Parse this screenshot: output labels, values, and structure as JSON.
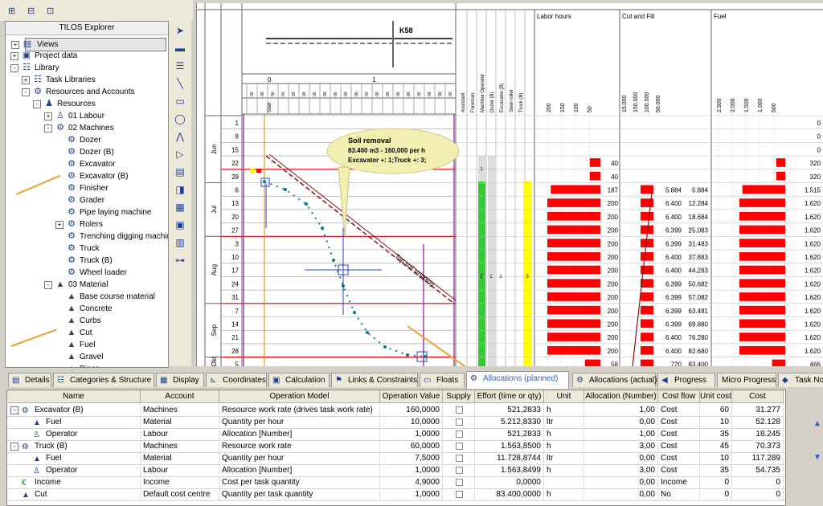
{
  "explorer": {
    "title": "TILOS Explorer",
    "items": [
      {
        "label": "Views",
        "level": 0,
        "exp": "+",
        "icon": "views-icon"
      },
      {
        "label": "Project data",
        "level": 0,
        "exp": "+",
        "icon": "project-data-icon"
      },
      {
        "label": "Library",
        "level": 0,
        "exp": "-",
        "icon": "library-icon"
      },
      {
        "label": "Task Libraries",
        "level": 1,
        "exp": "+",
        "icon": "task-library-icon"
      },
      {
        "label": "Resources and Accounts",
        "level": 1,
        "exp": "-",
        "icon": "resources-accounts-icon"
      },
      {
        "label": "Resources",
        "level": 2,
        "exp": "-",
        "icon": "resources-icon"
      },
      {
        "label": "01 Labour",
        "level": 3,
        "exp": "+",
        "icon": "labour-icon"
      },
      {
        "label": "02 Machines",
        "level": 3,
        "exp": "-",
        "icon": "machines-icon"
      },
      {
        "label": "Dozer",
        "level": 4,
        "exp": "",
        "icon": "machine-icon"
      },
      {
        "label": "Dozer (B)",
        "level": 4,
        "exp": "",
        "icon": "machine-icon"
      },
      {
        "label": "Excavator",
        "level": 4,
        "exp": "",
        "icon": "machine-icon"
      },
      {
        "label": "Excavator (B)",
        "level": 4,
        "exp": "",
        "icon": "machine-group-icon"
      },
      {
        "label": "Finisher",
        "level": 4,
        "exp": "",
        "icon": "machine-icon"
      },
      {
        "label": "Grader",
        "level": 4,
        "exp": "",
        "icon": "machine-icon"
      },
      {
        "label": "Pipe laying machine",
        "level": 4,
        "exp": "",
        "icon": "machine-icon"
      },
      {
        "label": "Rolers",
        "level": 4,
        "exp": "+",
        "icon": "machine-icon"
      },
      {
        "label": "Trenching digging machir",
        "level": 4,
        "exp": "",
        "icon": "machine-icon"
      },
      {
        "label": "Truck",
        "level": 4,
        "exp": "",
        "icon": "machine-icon"
      },
      {
        "label": "Truck (B)",
        "level": 4,
        "exp": "",
        "icon": "machine-group-icon"
      },
      {
        "label": "Wheel loader",
        "level": 4,
        "exp": "",
        "icon": "machine-icon"
      },
      {
        "label": "03 Material",
        "level": 3,
        "exp": "-",
        "icon": "material-group-icon"
      },
      {
        "label": "Base course material",
        "level": 4,
        "exp": "",
        "icon": "material-icon"
      },
      {
        "label": "Concrete",
        "level": 4,
        "exp": "",
        "icon": "material-icon"
      },
      {
        "label": "Curbs",
        "level": 4,
        "exp": "",
        "icon": "material-icon"
      },
      {
        "label": "Cut",
        "level": 4,
        "exp": "",
        "icon": "material-icon"
      },
      {
        "label": "Fuel",
        "level": 4,
        "exp": "",
        "icon": "material-icon"
      },
      {
        "label": "Gravel",
        "level": 4,
        "exp": "",
        "icon": "material-icon"
      },
      {
        "label": "Pipes",
        "level": 4,
        "exp": "",
        "icon": "material-icon"
      }
    ]
  },
  "chart": {
    "station_label": "K58",
    "km_labels": [
      "0",
      "1"
    ],
    "start_label": "Start",
    "months": [
      "Jun",
      "Jul",
      "Aug",
      "Sep",
      "Okt"
    ],
    "days": [
      "1",
      "8",
      "15",
      "22",
      "29",
      "6",
      "13",
      "20",
      "27",
      "3",
      "10",
      "17",
      "24",
      "31",
      "7",
      "14",
      "21",
      "28",
      "5"
    ],
    "resource_columns": [
      "Assistant",
      "Foreman",
      "Machine Operator",
      "Dozer (B)",
      "Excavator (B)",
      "Steel roller",
      "Truck (B)"
    ],
    "resource_values": [
      "1",
      "8",
      "1",
      "1",
      "3"
    ],
    "callout": {
      "line1": "Soil removal",
      "line2": "83.400 m3 - 160,000 per h",
      "line3": "Excavator +: 1;Truck +: 3;"
    },
    "task_label": "Top soil stripping",
    "labor": {
      "title": "Labor hours",
      "axis": [
        "200",
        "150",
        "100",
        "50"
      ],
      "values": [
        "40",
        "40",
        "187",
        "200",
        "200",
        "200",
        "200",
        "200",
        "200",
        "200",
        "200",
        "200",
        "200",
        "200",
        "200",
        "58"
      ]
    },
    "cutfill": {
      "title": "Cut and Fill",
      "axis": [
        "15.000",
        "150.000",
        "100.000",
        "50.000"
      ],
      "values": [
        [
          "5.884",
          "5.884"
        ],
        [
          "6.400",
          "12.284"
        ],
        [
          "6.400",
          "18.684"
        ],
        [
          "6.399",
          "25.083"
        ],
        [
          "6.399",
          "31.483"
        ],
        [
          "6.400",
          "37.883"
        ],
        [
          "6.400",
          "44.283"
        ],
        [
          "6.399",
          "50.682"
        ],
        [
          "6.399",
          "57.082"
        ],
        [
          "6.399",
          "63.481"
        ],
        [
          "6.399",
          "69.880"
        ],
        [
          "6.400",
          "76.280"
        ],
        [
          "6.400",
          "82.680"
        ],
        [
          "720",
          "83.400"
        ]
      ]
    },
    "fuel": {
      "title": "Fuel",
      "axis": [
        "2.500",
        "2.000",
        "1.500",
        "1.000",
        "500"
      ],
      "values": [
        "0",
        "0",
        "0",
        "320",
        "320",
        "1.515",
        "1.620",
        "1.620",
        "1.620",
        "1.620",
        "1.620",
        "1.620",
        "1.620",
        "1.620",
        "1.620",
        "1.620",
        "1.620",
        "1.620",
        "466"
      ]
    },
    "colors": {
      "labor_bar": "#ff0000",
      "resource_green": "#33cc33",
      "resource_yellow": "#ffff00",
      "curve": "#008080",
      "grid_line_red": "#e00000"
    }
  },
  "tabs": [
    {
      "label": "Details",
      "icon": "details-icon"
    },
    {
      "label": "Categories & Structure",
      "icon": "categories-icon"
    },
    {
      "label": "Display",
      "icon": "display-icon"
    },
    {
      "label": "Coordinates",
      "icon": "coordinates-icon"
    },
    {
      "label": "Calculation",
      "icon": "calculation-icon"
    },
    {
      "label": "Links & Constraints",
      "icon": "links-icon"
    },
    {
      "label": "Floats",
      "icon": "floats-icon"
    },
    {
      "label": "Allocations (planned)",
      "icon": "allocations-icon"
    },
    {
      "label": "Allocations (actual)",
      "icon": "allocations-actual-icon"
    },
    {
      "label": "Progress",
      "icon": "progress-icon"
    },
    {
      "label": "Micro Progress",
      "icon": ""
    },
    {
      "label": "Task No",
      "icon": "task-notes-icon"
    }
  ],
  "grid": {
    "headers": [
      "Name",
      "Account",
      "Operation Model",
      "Operation Value",
      "Supply",
      "Effort (time or qty)",
      "Unit",
      "Allocation (Number)",
      "Cost flow",
      "Unit cost",
      "Cost"
    ],
    "rows": [
      {
        "name": "Excavator (B)",
        "indent": 0,
        "exp": "-",
        "icon": "machine-group-icon",
        "account": "Machines",
        "model": "Resource work rate (drives task work rate)",
        "value": "160,0000",
        "effort": "521,2833",
        "unit": "h",
        "alloc": "1,00",
        "flow": "Cost",
        "ucost": "60",
        "cost": "31.277"
      },
      {
        "name": "Fuel",
        "indent": 1,
        "exp": "",
        "icon": "material-icon",
        "account": "Material",
        "model": "Quantity per hour",
        "value": "10,0000",
        "effort": "5.212,8330",
        "unit": "ltr",
        "alloc": "0,00",
        "flow": "Cost",
        "ucost": "10",
        "cost": "52.128"
      },
      {
        "name": "Operator",
        "indent": 1,
        "exp": "",
        "icon": "labour-icon",
        "account": "Labour",
        "model": "Allocation [Number]",
        "value": "1,0000",
        "effort": "521,2833",
        "unit": "h",
        "alloc": "1,00",
        "flow": "Cost",
        "ucost": "35",
        "cost": "18.245"
      },
      {
        "name": "Truck (B)",
        "indent": 0,
        "exp": "-",
        "icon": "machine-group-icon",
        "account": "Machines",
        "model": "Resource work rate",
        "value": "60,0000",
        "effort": "1.563,8500",
        "unit": "h",
        "alloc": "3,00",
        "flow": "Cost",
        "ucost": "45",
        "cost": "70.373"
      },
      {
        "name": "Fuel",
        "indent": 1,
        "exp": "",
        "icon": "material-icon",
        "account": "Material",
        "model": "Quantity per hour",
        "value": "7,5000",
        "effort": "11.728,8744",
        "unit": "ltr",
        "alloc": "0,00",
        "flow": "Cost",
        "ucost": "10",
        "cost": "117.289"
      },
      {
        "name": "Operator",
        "indent": 1,
        "exp": "",
        "icon": "labour-icon",
        "account": "Labour",
        "model": "Allocation [Number]",
        "value": "1,0000",
        "effort": "1.563,8499",
        "unit": "h",
        "alloc": "3,00",
        "flow": "Cost",
        "ucost": "35",
        "cost": "54.735"
      },
      {
        "name": "Income",
        "indent": 0,
        "exp": "",
        "icon": "income-icon",
        "account": "Income",
        "model": "Cost per task quantity",
        "value": "4,9000",
        "effort": "0,0000",
        "unit": "",
        "alloc": "0,00",
        "flow": "Income",
        "ucost": "0",
        "cost": "0"
      },
      {
        "name": "Cut",
        "indent": 0,
        "exp": "",
        "icon": "material-icon",
        "account": "Default cost centre",
        "model": "Quantity per task quantity",
        "value": "1,0000",
        "effort": "83.400,0000",
        "unit": "h",
        "alloc": "0,00",
        "flow": "No",
        "ucost": "0",
        "cost": "0"
      }
    ]
  }
}
